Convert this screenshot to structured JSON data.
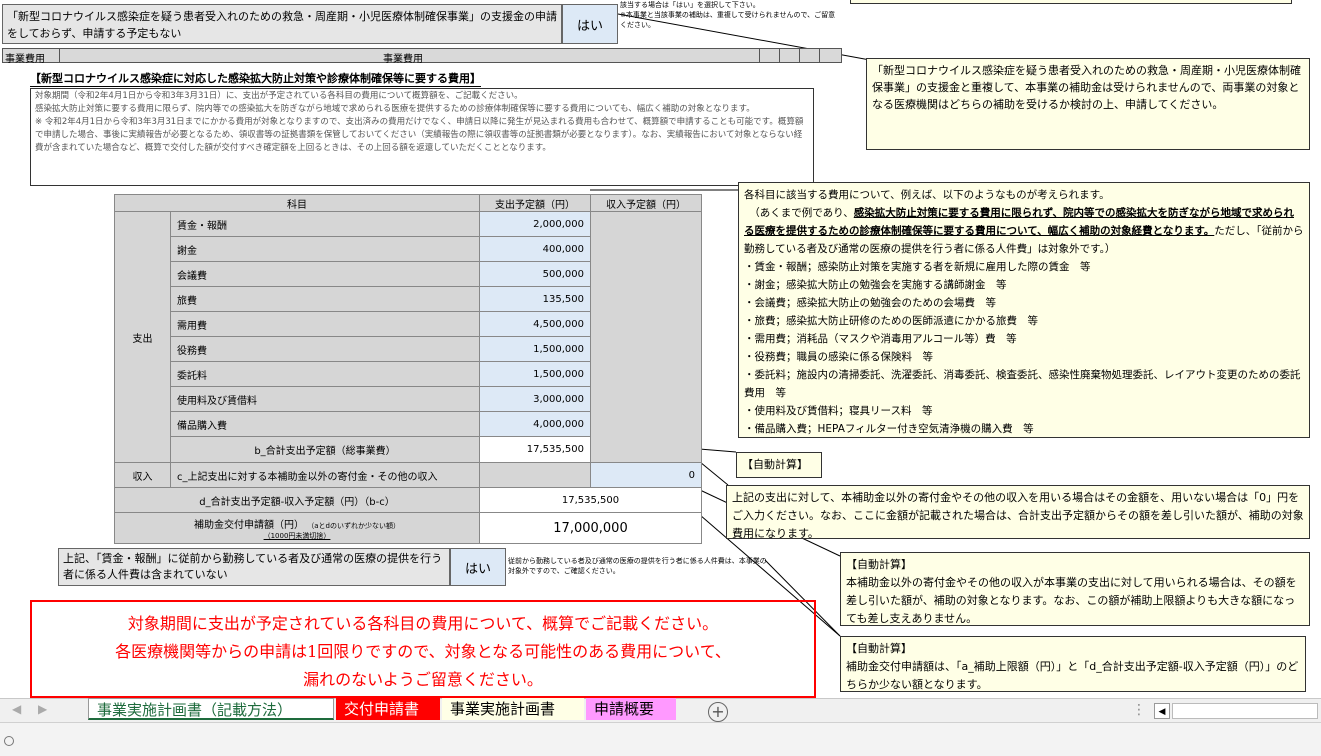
{
  "header": {
    "question_text": "「新型コロナウイルス感染症を疑う患者受入れのための救急・周産期・小児医療体制確保事業」の支援金の申請をしておらず、申請する予定もない",
    "answer": "はい",
    "side_note_line1": "該当する場合は「はい」を選択して下さい。",
    "side_note_line2": "※本事業と当該事業の補助は、重複して受けられませんので、ご留意ください。"
  },
  "section_bar": {
    "left": "事業費用",
    "center": "事業費用"
  },
  "section_title": "【新型コロナウイルス感染症に対応した感染拡大防止対策や診療体制確保等に要する費用】",
  "instructions": [
    "対象期間（令和2年4月1日から令和3年3月31日）に、支出が予定されている各科目の費用について概算額を、ご記載ください。",
    "感染拡大防止対策に要する費用に限らず、院内等での感染拡大を防ぎながら地域で求められる医療を提供するための診療体制確保等に要する費用についても、幅広く補助の対象となります。",
    "※ 令和2年4月1日から令和3年3月31日までにかかる費用が対象となりますので、支出済みの費用だけでなく、申請日以降に発生が見込まれる費用も合わせて、概算額で申請することも可能です。概算額で申請した場合、事後に実績報告が必要となるため、領収書等の証拠書類を保管しておいてください（実績報告の際に領収書等の証拠書類が必要となります）。なお、実績報告において対象とならない経費が含まれていた場合など、概算で交付した額が交付すべき確定額を上回るときは、その上回る額を返還していただくこととなります。"
  ],
  "table": {
    "headers": {
      "subject": "科目",
      "expense": "支出予定額（円）",
      "income": "収入予定額（円）"
    },
    "expense_group_label": "支出",
    "rows": [
      {
        "label": "賃金・報酬",
        "value": "2,000,000"
      },
      {
        "label": "謝金",
        "value": "400,000"
      },
      {
        "label": "会議費",
        "value": "500,000"
      },
      {
        "label": "旅費",
        "value": "135,500"
      },
      {
        "label": "需用費",
        "value": "4,500,000"
      },
      {
        "label": "役務費",
        "value": "1,500,000"
      },
      {
        "label": "委託料",
        "value": "1,500,000"
      },
      {
        "label": "使用料及び賃借料",
        "value": "3,000,000"
      },
      {
        "label": "備品購入費",
        "value": "4,000,000"
      }
    ],
    "total_label": "b_合計支出予定額（総事業費）",
    "total_value": "17,535,500",
    "income_group_label": "収入",
    "income_label": "c_上記支出に対する本補助金以外の寄付金・その他の収入",
    "income_value": "0",
    "d_label": "d_合計支出予定額-収入予定額（円）（b-c）",
    "d_value": "17,535,500",
    "grant_label": "補助金交付申請額（円）",
    "grant_sub": "（aとdのいずれか少ない額）",
    "grant_sub2": "（1000円未満切捨）",
    "grant_value": "17,000,000"
  },
  "bottom_question": {
    "text": "上記、「賃金・報酬」に従前から勤務している者及び通常の医療の提供を行う者に係る人件費は含まれていない",
    "answer": "はい",
    "side_note": "従前から勤務している者及び通常の医療の提供を行う者に係る人件費は、本事業の対象外ですので、ご確認ください。"
  },
  "red_box_lines": [
    "対象期間に支出が予定されている各科目の費用について、概算でご記載ください。",
    "各医療機関等からの申請は1回限りですので、対象となる可能性のある費用について、",
    "漏れのないようご留意ください。"
  ],
  "notes": {
    "note1": "「新型コロナウイルス感染症を疑う患者受入れのための救急・周産期・小児医療体制確保事業」の支援金と重複して、本事業の補助金は受けられませんので、両事業の対象となる医療機関はどちらの補助を受けるか検討の上、申請してください。",
    "note2_intro": "各科目に該当する費用について、例えば、以下のようなものが考えられます。",
    "note2_paren_a": "（あくまで例であり、",
    "note2_bold": "感染拡大防止対策に要する費用に限られず、院内等での感染拡大を防ぎながら地域で求められる医療を提供するための診療体制確保等に要する費用について、幅広く補助の対象経費となります。",
    "note2_paren_b": "ただし、「従前から勤務している者及び通常の医療の提供を行う者に係る人件費」は対象外です。）",
    "note2_items": [
      "・賃金・報酬；感染防止対策を実施する者を新規に雇用した際の賃金　等",
      "・謝金；感染拡大防止の勉強会を実施する講師謝金　等",
      "・会議費；感染拡大防止の勉強会のための会場費　等",
      "・旅費；感染拡大防止研修のための医師派遣にかかる旅費　等",
      "・需用費；消耗品（マスクや消毒用アルコール等）費　等",
      "・役務費；職員の感染に係る保険料　等",
      "・委託料；施設内の清掃委託、洗濯委託、消毒委託、検査委託、感染性廃棄物処理委託、レイアウト変更のための委託費用　等",
      "・使用料及び賃借料；寝具リース料　等",
      "・備品購入費；HEPAフィルター付き空気清浄機の購入費　等"
    ],
    "auto_calc": "【自動計算】",
    "note3": "上記の支出に対して、本補助金以外の寄付金やその他の収入を用いる場合はその金額を、用いない場合は「0」円をご入力ください。なお、ここに金額が記載された場合は、合計支出予定額からその額を差し引いた額が、補助の対象費用になります。",
    "note4": "本補助金以外の寄付金やその他の収入が本事業の支出に対して用いられる場合は、その額を差し引いた額が、補助の対象となります。なお、この額が補助上限額よりも大きな額になっても差し支えありません。",
    "note5": "補助金交付申請額は、「a_補助上限額（円）」と「d_合計支出予定額-収入予定額（円）」のどちらか少ない額となります。"
  },
  "tabs": [
    {
      "label": "事業実施計画書（記載方法）"
    },
    {
      "label": "交付申請書"
    },
    {
      "label": "事業実施計画書"
    },
    {
      "label": "申請概要"
    }
  ],
  "colors": {
    "red": "#ff0000",
    "note_bg": "#ffffe6",
    "blue_cell": "#dde9f6",
    "gray_cell": "#d6d6d6",
    "pink_tab": "#ff99ff"
  }
}
